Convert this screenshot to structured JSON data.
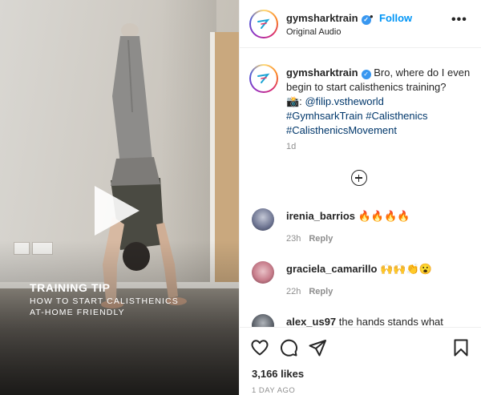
{
  "media": {
    "overlay_title": "TRAINING TIP",
    "overlay_subtitle": "HOW TO START CALISTHENICS AT-HOME FRIENDLY"
  },
  "header": {
    "username": "gymsharktrain",
    "separator": "•",
    "follow_label": "Follow",
    "audio": "Original Audio",
    "more_label": "•••"
  },
  "caption": {
    "username": "gymsharktrain",
    "text": "Bro, where do I even begin to start calisthenics training?",
    "credit_prefix": "📸:",
    "credit_handle": "@filip.vstheworld",
    "hashtags": "#GymhsarkTrain #Calisthenics #CalisthenicsMovement",
    "time": "1d"
  },
  "comments": [
    {
      "username": "irenia_barrios",
      "text": "🔥🔥🔥🔥",
      "time": "23h",
      "reply": "Reply"
    },
    {
      "username": "graciela_camarillo",
      "text": "🙌🙌👏😮",
      "time": "22h",
      "reply": "Reply"
    },
    {
      "username": "alex_us97",
      "text": "the hands stands what"
    }
  ],
  "actions": {
    "likes": "3,166 likes",
    "posted": "1 DAY AGO"
  },
  "colors": {
    "brand_blue": "#0095f6",
    "verified": "#3897f0",
    "hashtag": "#00376b",
    "muted": "#8e8e8e"
  },
  "icons": [
    "verified-badge-icon",
    "more-options-icon",
    "add-circle-icon",
    "heart-icon",
    "comment-icon",
    "share-icon",
    "bookmark-icon",
    "play-icon"
  ]
}
